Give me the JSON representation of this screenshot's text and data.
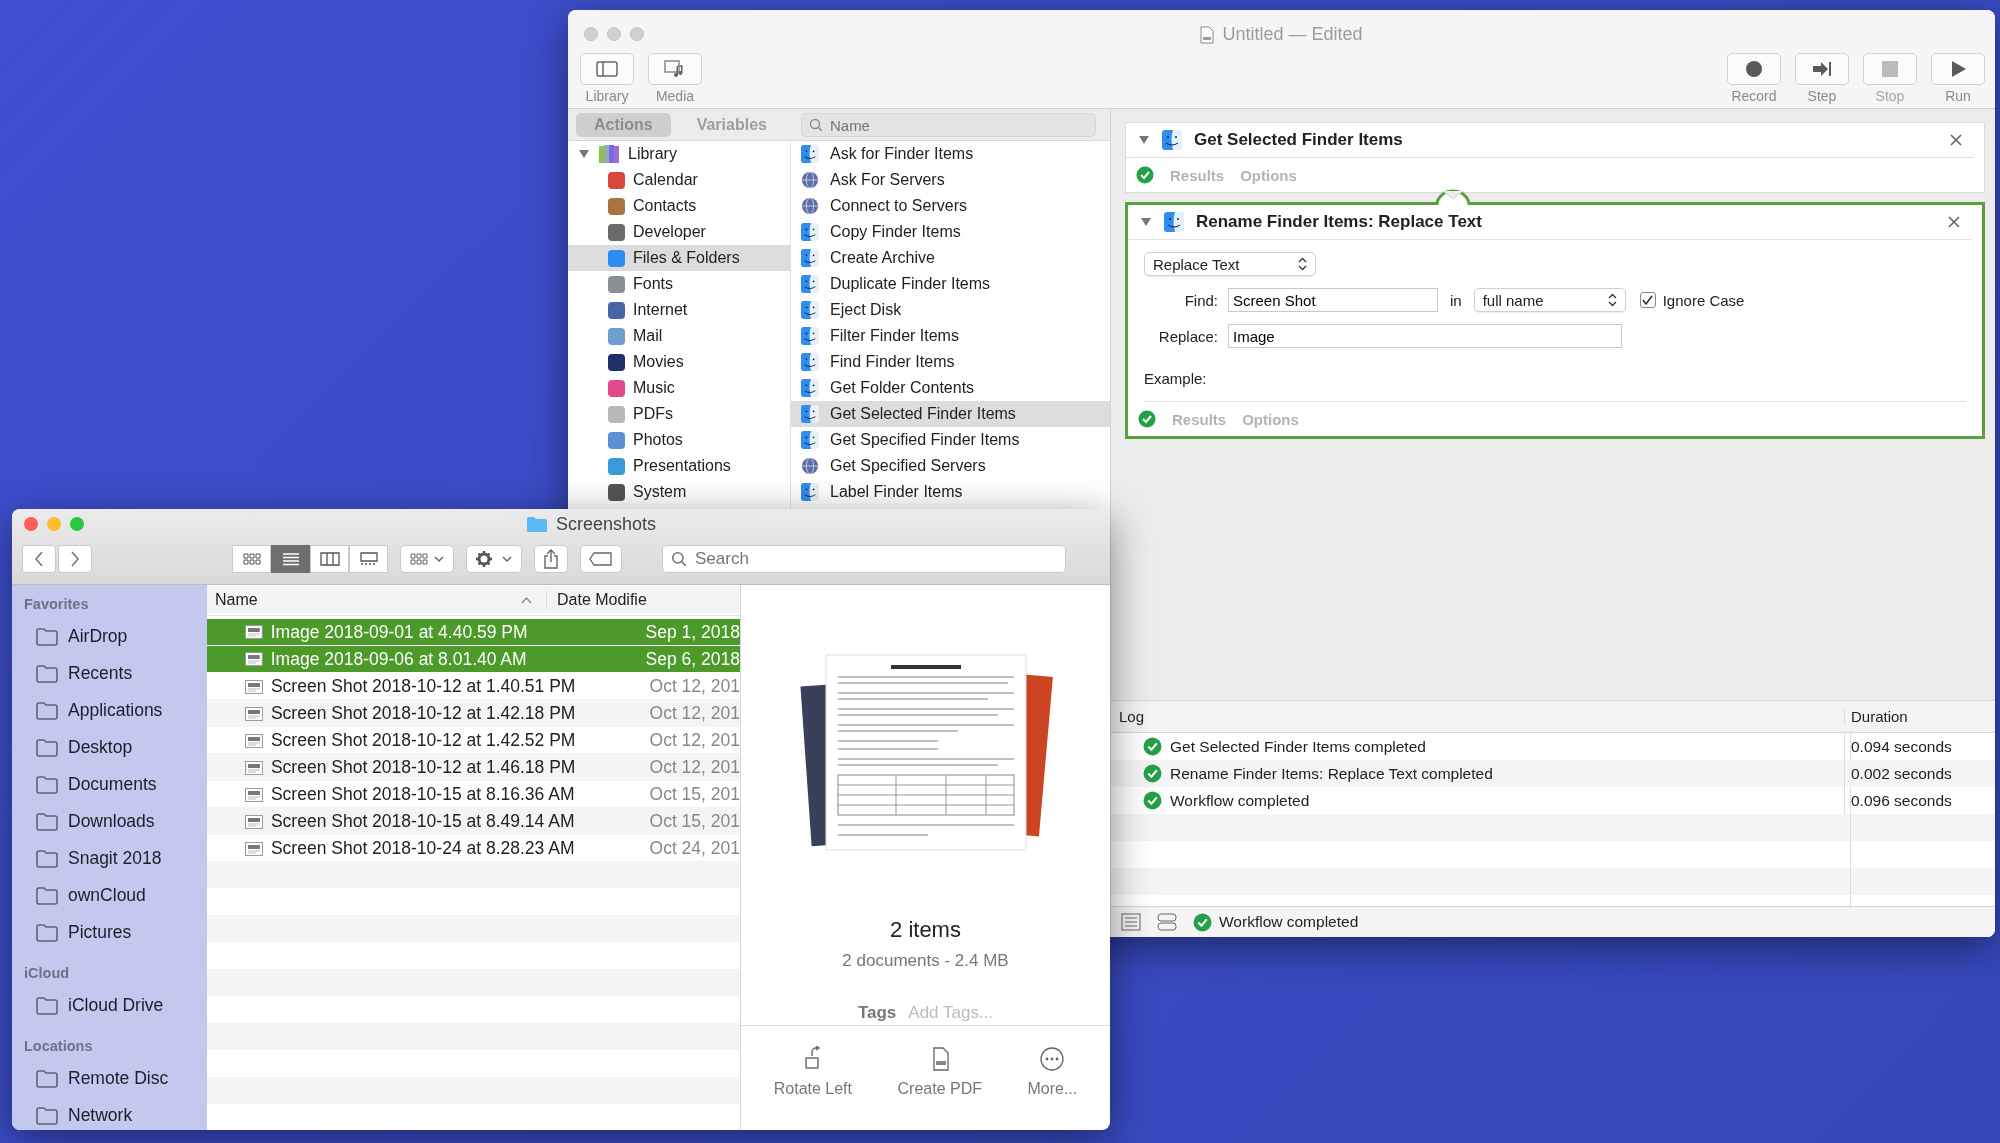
{
  "automator": {
    "title": "Untitled — Edited",
    "toolbar_left": [
      {
        "label": "Library"
      },
      {
        "label": "Media"
      }
    ],
    "toolbar_right": [
      {
        "label": "Record",
        "disabled": false
      },
      {
        "label": "Step",
        "disabled": false
      },
      {
        "label": "Stop",
        "disabled": true
      },
      {
        "label": "Run",
        "disabled": false
      }
    ],
    "tabs": [
      {
        "label": "Actions",
        "selected": true
      },
      {
        "label": "Variables",
        "selected": false
      }
    ],
    "search": {
      "placeholder": "Name"
    },
    "library": {
      "label": "Library",
      "expanded": true,
      "children": [
        {
          "label": "Calendar",
          "selected": false
        },
        {
          "label": "Contacts",
          "selected": false
        },
        {
          "label": "Developer",
          "selected": false
        },
        {
          "label": "Files & Folders",
          "selected": true
        },
        {
          "label": "Fonts",
          "selected": false
        },
        {
          "label": "Internet",
          "selected": false
        },
        {
          "label": "Mail",
          "selected": false
        },
        {
          "label": "Movies",
          "selected": false
        },
        {
          "label": "Music",
          "selected": false
        },
        {
          "label": "PDFs",
          "selected": false
        },
        {
          "label": "Photos",
          "selected": false
        },
        {
          "label": "Presentations",
          "selected": false
        },
        {
          "label": "System",
          "selected": false
        }
      ]
    },
    "actions": [
      {
        "label": "Ask for Finder Items",
        "kind": "finder",
        "selected": false
      },
      {
        "label": "Ask For Servers",
        "kind": "globe",
        "selected": false
      },
      {
        "label": "Connect to Servers",
        "kind": "globe",
        "selected": false
      },
      {
        "label": "Copy Finder Items",
        "kind": "finder",
        "selected": false
      },
      {
        "label": "Create Archive",
        "kind": "finder",
        "selected": false
      },
      {
        "label": "Duplicate Finder Items",
        "kind": "finder",
        "selected": false
      },
      {
        "label": "Eject Disk",
        "kind": "finder",
        "selected": false
      },
      {
        "label": "Filter Finder Items",
        "kind": "finder",
        "selected": false
      },
      {
        "label": "Find Finder Items",
        "kind": "finder",
        "selected": false
      },
      {
        "label": "Get Folder Contents",
        "kind": "finder",
        "selected": false
      },
      {
        "label": "Get Selected Finder Items",
        "kind": "finder",
        "selected": true
      },
      {
        "label": "Get Specified Finder Items",
        "kind": "finder",
        "selected": false
      },
      {
        "label": "Get Specified Servers",
        "kind": "globe",
        "selected": false
      },
      {
        "label": "Label Finder Items",
        "kind": "finder",
        "selected": false
      }
    ],
    "workflow": [
      {
        "title": "Get Selected Finder Items",
        "expanded": true,
        "selected": false,
        "footer": [
          "Results",
          "Options"
        ]
      },
      {
        "title": "Rename Finder Items: Replace Text",
        "expanded": true,
        "selected": true,
        "footer": [
          "Results",
          "Options"
        ],
        "settings": {
          "mode": "Replace Text",
          "find_label": "Find:",
          "find": "Screen Shot",
          "in_label": "in",
          "scope": "full name",
          "ignore_case": {
            "label": "Ignore Case",
            "checked": true
          },
          "replace_label": "Replace:",
          "replace": "Image",
          "example_label": "Example:"
        }
      }
    ],
    "log": {
      "columns": [
        "Log",
        "Duration"
      ],
      "rows": [
        {
          "message": "Get Selected Finder Items completed",
          "duration": "0.094 seconds"
        },
        {
          "message": "Rename Finder Items: Replace Text completed",
          "duration": "0.002 seconds"
        },
        {
          "message": "Workflow completed",
          "duration": "0.096 seconds"
        }
      ]
    },
    "status": "Workflow completed"
  },
  "finder": {
    "title": "Screenshots",
    "view_modes": [
      {
        "selected": false
      },
      {
        "selected": true
      },
      {
        "selected": false
      },
      {
        "selected": false
      }
    ],
    "search": {
      "placeholder": "Search"
    },
    "sidebar": [
      {
        "heading": "Favorites",
        "items": [
          {
            "label": "AirDrop"
          },
          {
            "label": "Recents"
          },
          {
            "label": "Applications"
          },
          {
            "label": "Desktop"
          },
          {
            "label": "Documents"
          },
          {
            "label": "Downloads"
          },
          {
            "label": "Snagit 2018"
          },
          {
            "label": "ownCloud"
          },
          {
            "label": "Pictures"
          }
        ]
      },
      {
        "heading": "iCloud",
        "items": [
          {
            "label": "iCloud Drive"
          }
        ]
      },
      {
        "heading": "Locations",
        "items": [
          {
            "label": "Remote Disc"
          },
          {
            "label": "Network"
          }
        ]
      }
    ],
    "columns": [
      "Name",
      "Date Modifie"
    ],
    "files": [
      {
        "name": "Image 2018-09-01 at 4.40.59 PM",
        "date": "Sep 1, 2018",
        "selected": true
      },
      {
        "name": "Image 2018-09-06 at 8.01.40 AM",
        "date": "Sep 6, 2018",
        "selected": true
      },
      {
        "name": "Screen Shot 2018-10-12 at 1.40.51 PM",
        "date": "Oct 12, 201",
        "selected": false
      },
      {
        "name": "Screen Shot 2018-10-12 at 1.42.18 PM",
        "date": "Oct 12, 201",
        "selected": false
      },
      {
        "name": "Screen Shot 2018-10-12 at 1.42.52 PM",
        "date": "Oct 12, 201",
        "selected": false
      },
      {
        "name": "Screen Shot 2018-10-12 at 1.46.18 PM",
        "date": "Oct 12, 201",
        "selected": false
      },
      {
        "name": "Screen Shot 2018-10-15 at 8.16.36 AM",
        "date": "Oct 15, 201",
        "selected": false
      },
      {
        "name": "Screen Shot 2018-10-15 at 8.49.14 AM",
        "date": "Oct 15, 201",
        "selected": false
      },
      {
        "name": "Screen Shot 2018-10-24 at 8.28.23 AM",
        "date": "Oct 24, 201",
        "selected": false
      }
    ],
    "preview": {
      "count": "2 items",
      "detail": "2 documents - 2.4 MB",
      "tags_label": "Tags",
      "tags_placeholder": "Add Tags...",
      "actions": [
        {
          "label": "Rotate Left"
        },
        {
          "label": "Create PDF"
        },
        {
          "label": "More..."
        }
      ]
    }
  }
}
